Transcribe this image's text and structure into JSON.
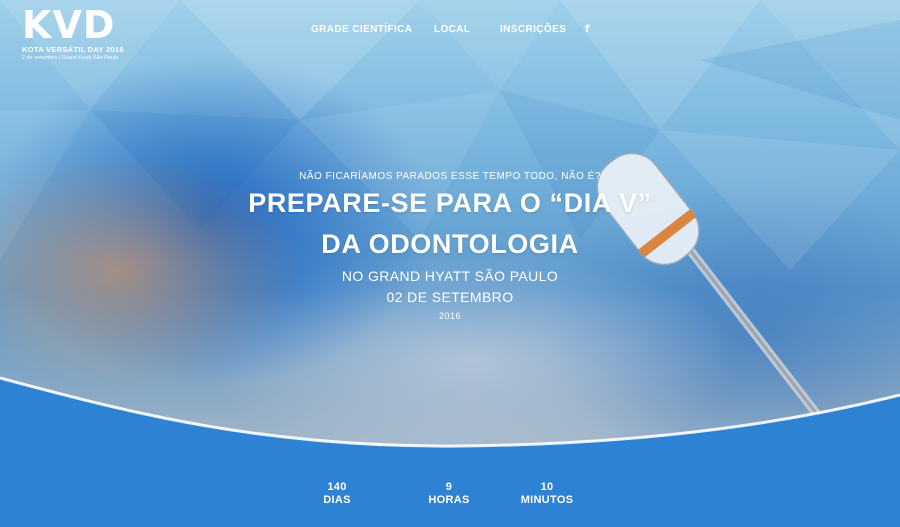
{
  "logo": {
    "mark": "KVD",
    "name": "KOTA VERSÁTIL DAY 2016",
    "subtitle": "2 de setembro | Grand Hyatt São Paulo"
  },
  "nav": {
    "items": [
      {
        "label": "GRADE CIENTÍFICA"
      },
      {
        "label": "LOCAL"
      },
      {
        "label": "INSCRIÇÕES"
      }
    ],
    "facebook": "f"
  },
  "hero": {
    "kicker": "NÃO FICARÍAMOS PARADOS ESSE TEMPO TODO, NÃO É?",
    "headline_line1": "PREPARE-SE PARA O “DIA V”",
    "headline_line2": "DA ODONTOLOGIA",
    "location_line1": "NO GRAND HYATT SÃO PAULO",
    "location_line2": "02 DE SETEMBRO",
    "year": "2016"
  },
  "countdown": [
    {
      "value": "140",
      "unit": "DIAS"
    },
    {
      "value": "9",
      "unit": "HORAS"
    },
    {
      "value": "10",
      "unit": "MINUTOS"
    }
  ],
  "colors": {
    "accent_blue": "#2e82d4",
    "text": "#ffffff"
  }
}
